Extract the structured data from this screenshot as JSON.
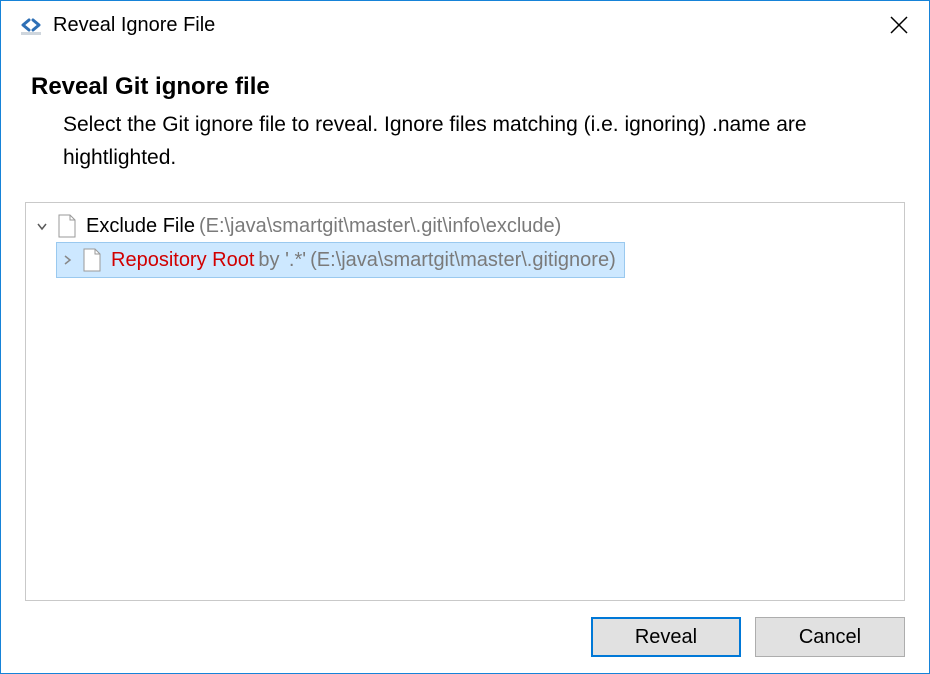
{
  "window": {
    "title": "Reveal Ignore File"
  },
  "header": {
    "heading": "Reveal Git ignore file",
    "description": "Select the Git ignore file to reveal. Ignore files matching (i.e. ignoring) .name are hightlighted."
  },
  "tree": {
    "root": {
      "label": "Exclude File",
      "path": "(E:\\java\\smartgit\\master\\.git\\info\\exclude)",
      "expanded": true
    },
    "child": {
      "label": "Repository Root",
      "by_prefix": "by ",
      "pattern": "'.*'",
      "path": "(E:\\java\\smartgit\\master\\.gitignore)",
      "expanded": false,
      "selected": true,
      "highlighted": true
    }
  },
  "buttons": {
    "reveal": "Reveal",
    "cancel": "Cancel"
  }
}
